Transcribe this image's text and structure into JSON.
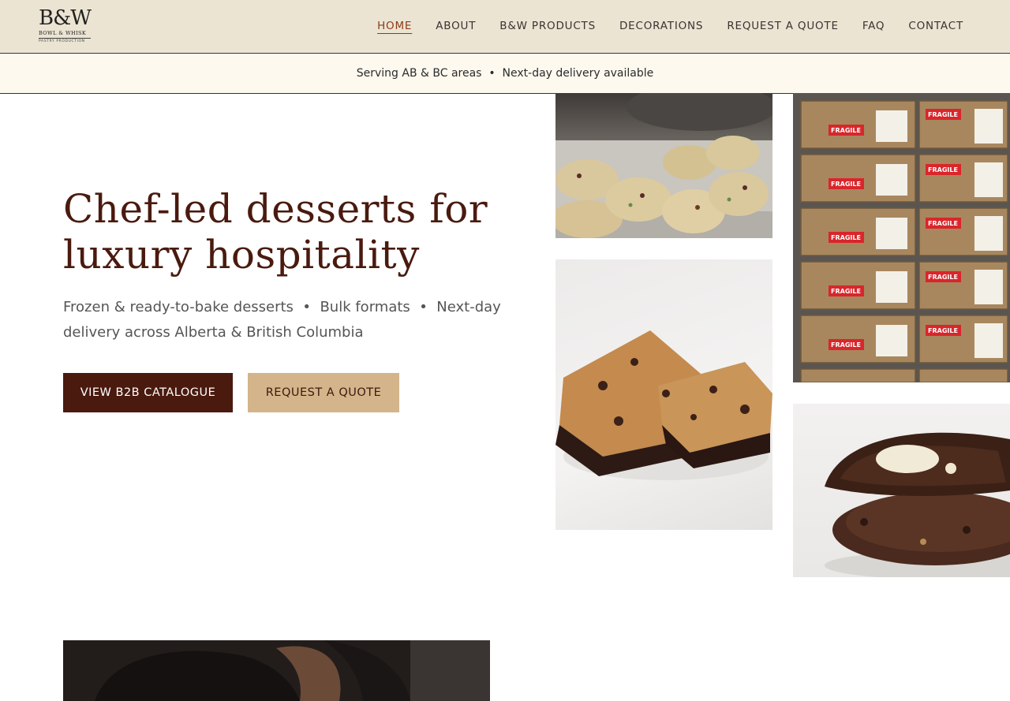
{
  "logo": {
    "mark": "B&W",
    "line1": "BOWL & WHISK",
    "line2": "PASTRY PRODUCTION"
  },
  "nav": {
    "items": [
      {
        "label": "HOME",
        "active": true
      },
      {
        "label": "ABOUT"
      },
      {
        "label": "B&W PRODUCTS"
      },
      {
        "label": "DECORATIONS"
      },
      {
        "label": "REQUEST A QUOTE"
      },
      {
        "label": "FAQ"
      },
      {
        "label": "CONTACT"
      }
    ]
  },
  "banner": {
    "text": "Serving AB & BC areas  •  Next-day delivery available"
  },
  "hero": {
    "title": "Chef-led desserts for luxury hospitality",
    "subtitle": "Frozen & ready-to-bake desserts  •  Bulk formats  •  Next-day delivery across Alberta & British Columbia",
    "primary_button": "VIEW B2B CATALOGUE",
    "secondary_button": "REQUEST A QUOTE"
  },
  "gallery": {
    "boxes_label": "FRAGILE"
  },
  "colors": {
    "brand_dark": "#4a1a0f",
    "brand_tan": "#d4b48a",
    "header_bg": "#ece4d3",
    "banner_bg": "#fdf9ef",
    "nav_active": "#8a3d1b"
  }
}
